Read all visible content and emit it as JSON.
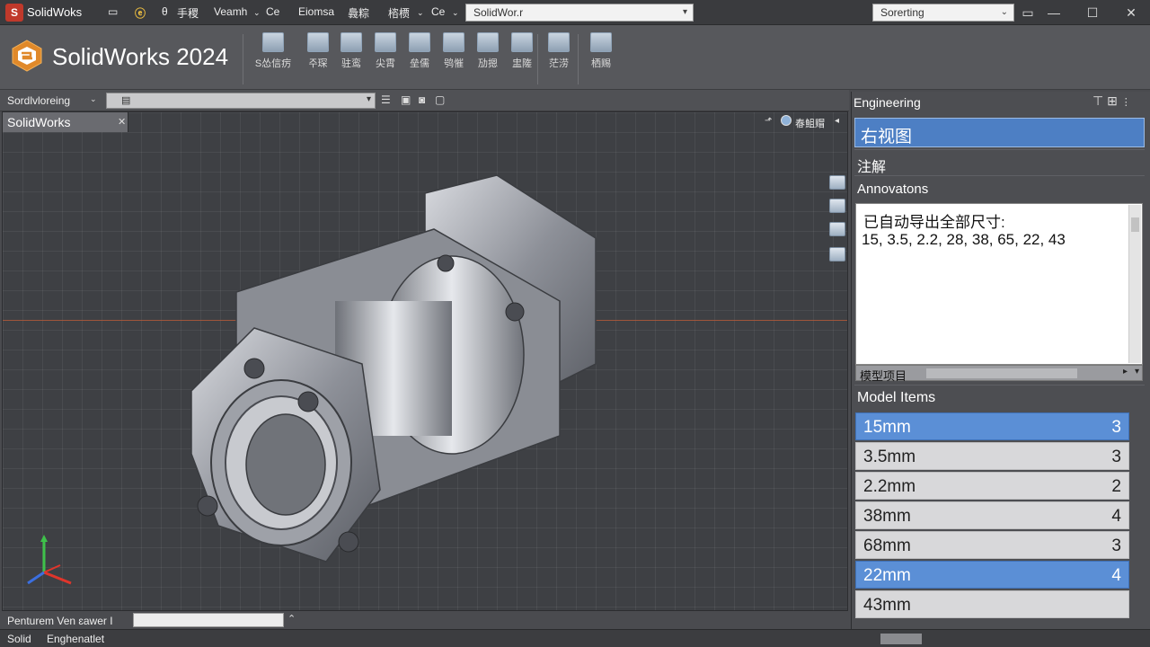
{
  "titlebar": {
    "app_name": "SolidWoks",
    "menus": [
      "θ",
      "手稷",
      "Veamh",
      "Ce",
      "Eiomsa",
      "䳗粽",
      "㮞槚",
      "Ce"
    ],
    "doc_combo": "SolidWor.r",
    "sort_combo": "Sorerting"
  },
  "ribbon": {
    "brand": "SolidWorks 2024",
    "buttons": [
      "S怂信疠",
      "주琛",
      "驻鸾",
      "尖霄",
      "垒儒",
      "鸮慛",
      "劢摁",
      "盅隓",
      "茫涝",
      "栖赐"
    ]
  },
  "subbar": {
    "label": "Sordlvloreing"
  },
  "viewport": {
    "tab_label": "SolidWorks",
    "view_label": "㫪䱉赗"
  },
  "cmdbar": {
    "label": "Penturem  Ven ɛawer I"
  },
  "statusbar": {
    "left": "Solid",
    "right": "Enghenatlet"
  },
  "panel": {
    "title": "Engineering",
    "view_name": "右视图",
    "annot_zh": "注解",
    "annot_en": "Annovatons",
    "export_line1": "已自动导出全部尺寸:",
    "export_line2": "15, 3.5, 2.2, 28, 38, 65, 22, 43",
    "hscroll_label": "模型项目",
    "items_header": "Model Items",
    "items": [
      {
        "value": "15mm",
        "count": "3",
        "selected": true
      },
      {
        "value": "3.5mm",
        "count": "3",
        "selected": false
      },
      {
        "value": "2.2mm",
        "count": "2",
        "selected": false
      },
      {
        "value": "38mm",
        "count": "4",
        "selected": false
      },
      {
        "value": "68mm",
        "count": "3",
        "selected": false
      },
      {
        "value": "22mm",
        "count": "4",
        "selected": true
      },
      {
        "value": "43mm",
        "count": "",
        "selected": false
      }
    ]
  }
}
